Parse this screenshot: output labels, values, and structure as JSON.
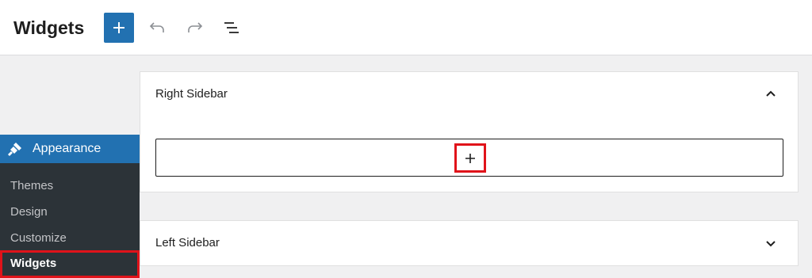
{
  "header": {
    "title": "Widgets",
    "toolbar": {
      "add_icon": "plus-icon",
      "undo_icon": "undo-icon",
      "redo_icon": "redo-icon",
      "list_view_icon": "list-view-icon"
    }
  },
  "admin_menu": {
    "section": {
      "label": "Appearance",
      "icon": "paintbrush-icon"
    },
    "items": [
      {
        "label": "Themes",
        "current": false
      },
      {
        "label": "Design",
        "current": false
      },
      {
        "label": "Customize",
        "current": false
      },
      {
        "label": "Widgets",
        "current": true
      }
    ]
  },
  "widget_areas": [
    {
      "title": "Right Sidebar",
      "expanded": true,
      "appender_icon": "plus-icon"
    },
    {
      "title": "Left Sidebar",
      "expanded": false
    }
  ],
  "colors": {
    "accent": "#2271b1",
    "highlight": "#e0131a",
    "menu_bg": "#1d2327",
    "submenu_bg": "#2c3338"
  }
}
